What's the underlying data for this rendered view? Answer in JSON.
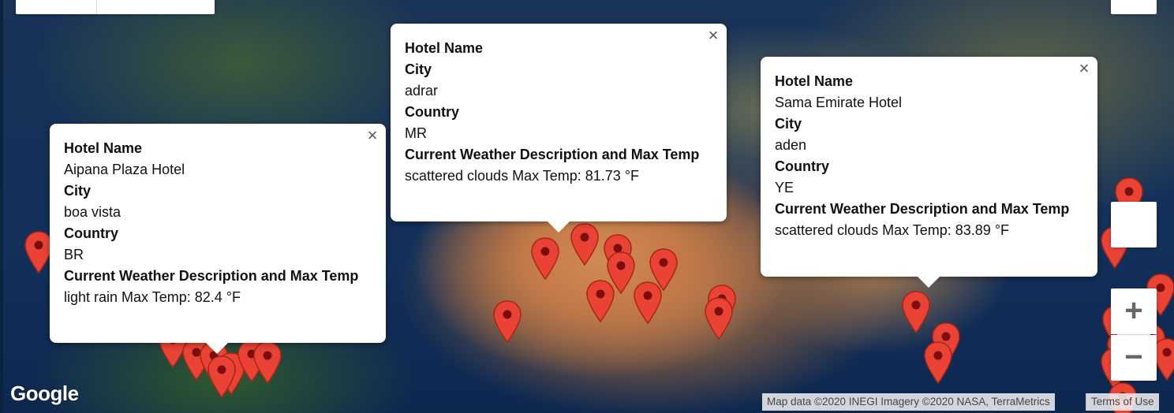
{
  "popups": [
    {
      "hotel_label": "Hotel Name",
      "hotel": "Aipana Plaza Hotel",
      "city_label": "City",
      "city": "boa vista",
      "country_label": "Country",
      "country": "BR",
      "weather_label": "Current Weather Description and Max Temp",
      "weather": "light rain Max Temp: 82.4 °F",
      "close": "×"
    },
    {
      "hotel_label": "Hotel Name",
      "hotel": "",
      "city_label": "City",
      "city": "adrar",
      "country_label": "Country",
      "country": "MR",
      "weather_label": "Current Weather Description and Max Temp",
      "weather": "scattered clouds Max Temp: 81.73 °F",
      "close": "×"
    },
    {
      "hotel_label": "Hotel Name",
      "hotel": "Sama Emirate Hotel",
      "city_label": "City",
      "city": "aden",
      "country_label": "Country",
      "country": "YE",
      "weather_label": "Current Weather Description and Max Temp",
      "weather": "scattered clouds Max Temp: 83.89 °F",
      "close": "×"
    }
  ],
  "controls": {
    "zoom_in": "+",
    "zoom_out": "−"
  },
  "branding": {
    "logo": "Google",
    "attribution": "Map data ©2020 INEGI Imagery ©2020 NASA, TerraMetrics",
    "terms": "Terms of Use"
  },
  "colors": {
    "marker_fill": "#ea4335",
    "marker_stroke": "#a52714",
    "marker_dot": "#7a0e0e"
  }
}
